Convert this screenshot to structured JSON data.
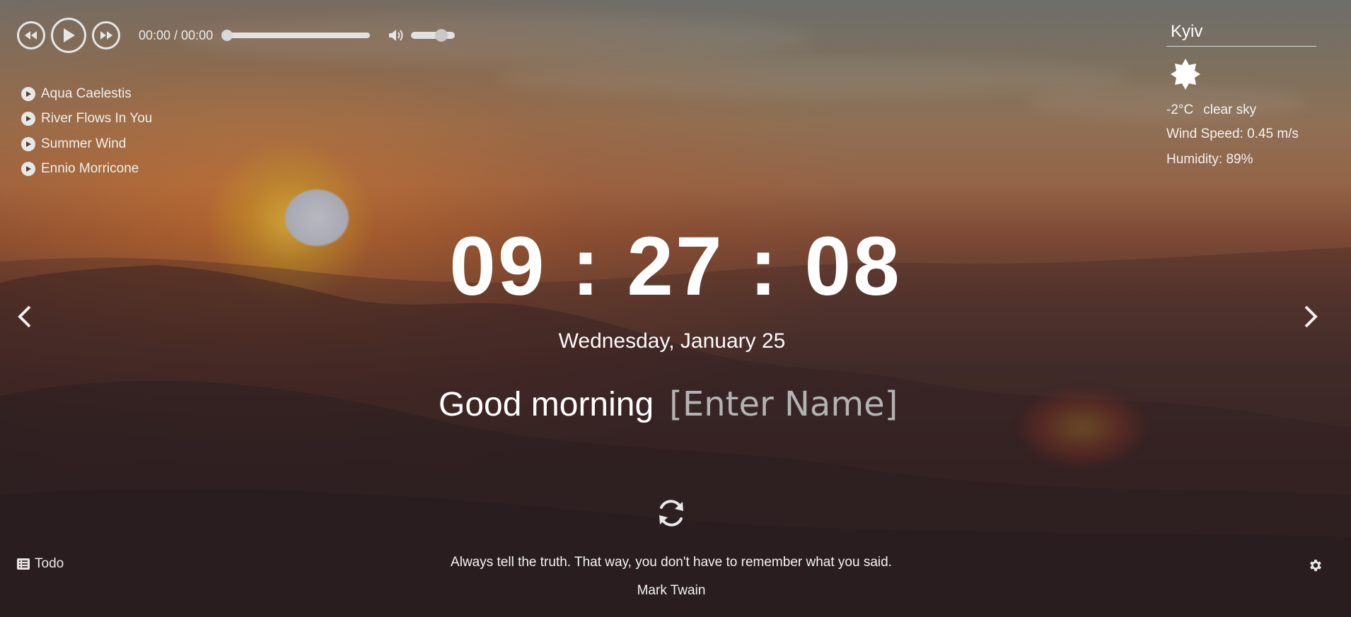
{
  "player": {
    "time_display": "00:00 / 00:00",
    "progress": 0,
    "volume": 0.6,
    "icons": [
      "rewind-icon",
      "play-icon",
      "fast-forward-icon",
      "volume-icon"
    ]
  },
  "playlist": [
    {
      "title": "Aqua Caelestis"
    },
    {
      "title": "River Flows In You"
    },
    {
      "title": "Summer Wind"
    },
    {
      "title": "Ennio Morricone"
    }
  ],
  "weather": {
    "city": "Kyiv",
    "icon": "clear-sky-sun-icon",
    "temperature": "-2°C",
    "description": "clear sky",
    "wind": "Wind Speed: 0.45 m/s",
    "humidity": "Humidity: 89%"
  },
  "clock": {
    "time": "09 : 27 : 08",
    "date": "Wednesday, January 25"
  },
  "greeting": {
    "text": "Good morning",
    "name_placeholder": "[Enter Name]"
  },
  "quote": {
    "text": "Always tell the truth. That way, you don't have to remember what you said.",
    "author": "Mark Twain"
  },
  "footer": {
    "todo_label": "Todo"
  }
}
